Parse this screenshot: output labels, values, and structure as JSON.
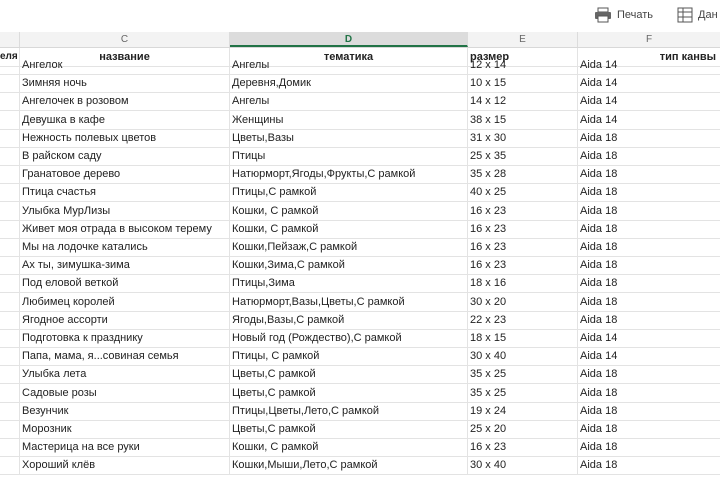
{
  "toolbar": {
    "print_label": "Печать",
    "data_label": "Дан"
  },
  "columns": {
    "stub": "еля",
    "c": "C",
    "d": "D",
    "e": "E",
    "f": "F"
  },
  "header_row": {
    "name": "название",
    "theme": "тематика",
    "size": "размер",
    "canvas": "тип канвы"
  },
  "rows": [
    {
      "name": "Ангелок",
      "theme": "Ангелы",
      "size": "12 x 14",
      "canvas": "Aida 14"
    },
    {
      "name": "Зимняя ночь",
      "theme": "Деревня,Домик",
      "size": "10 x 15",
      "canvas": "Aida 14"
    },
    {
      "name": "Ангелочек в розовом",
      "theme": "Ангелы",
      "size": "14 x 12",
      "canvas": "Aida 14"
    },
    {
      "name": "Девушка в кафе",
      "theme": "Женщины",
      "size": "38 x 15",
      "canvas": "Aida 14"
    },
    {
      "name": "Нежность полевых цветов",
      "theme": "Цветы,Вазы",
      "size": "31 x 30",
      "canvas": "Aida 18"
    },
    {
      "name": "В райском саду",
      "theme": "Птицы",
      "size": "25 x 35",
      "canvas": "Aida 18"
    },
    {
      "name": "Гранатовое дерево",
      "theme": "Натюрморт,Ягоды,Фрукты,С рамкой",
      "size": "35 x 28",
      "canvas": "Aida 18"
    },
    {
      "name": "Птица счастья",
      "theme": "Птицы,С рамкой",
      "size": "40 x 25",
      "canvas": "Aida 18"
    },
    {
      "name": "Улыбка МурЛизы",
      "theme": "Кошки, С рамкой",
      "size": "16 x 23",
      "canvas": "Aida 18"
    },
    {
      "name": "Живет моя отрада в высоком терему",
      "theme": "Кошки, С рамкой",
      "size": "16 x 23",
      "canvas": "Aida 18"
    },
    {
      "name": "Мы на лодочке катались",
      "theme": "Кошки,Пейзаж,С рамкой",
      "size": "16 x 23",
      "canvas": "Aida 18"
    },
    {
      "name": "Ах ты, зимушка-зима",
      "theme": "Кошки,Зима,С рамкой",
      "size": "16 x 23",
      "canvas": "Aida 18"
    },
    {
      "name": "Под еловой веткой",
      "theme": "Птицы,Зима",
      "size": "18 x 16",
      "canvas": "Aida 18"
    },
    {
      "name": "Любимец королей",
      "theme": "Натюрморт,Вазы,Цветы,С рамкой",
      "size": "30 x 20",
      "canvas": "Aida 18"
    },
    {
      "name": "Ягодное ассорти",
      "theme": "Ягоды,Вазы,С рамкой",
      "size": " 22 x 23",
      "canvas": "Aida 18"
    },
    {
      "name": "Подготовка к празднику",
      "theme": "Новый год (Рождество),С рамкой",
      "size": "18 x 15",
      "canvas": "Aida 14"
    },
    {
      "name": "Папа, мама, я...совиная семья",
      "theme": "Птицы, С рамкой",
      "size": "30 x 40",
      "canvas": "Aida 14"
    },
    {
      "name": "Улыбка лета",
      "theme": "Цветы,С рамкой",
      "size": "35 x 25",
      "canvas": "Aida 18"
    },
    {
      "name": "Садовые розы",
      "theme": "Цветы,С рамкой",
      "size": "35 x 25",
      "canvas": "Aida 18"
    },
    {
      "name": "Везунчик",
      "theme": "Птицы,Цветы,Лето,С рамкой",
      "size": "19 x 24",
      "canvas": "Aida 18"
    },
    {
      "name": "Морозник",
      "theme": "Цветы,С рамкой",
      "size": "25 x 20",
      "canvas": "Aida 18"
    },
    {
      "name": "Мастерица на все руки",
      "theme": "Кошки, С рамкой",
      "size": "16 x 23",
      "canvas": "Aida 18"
    },
    {
      "name": "Хороший клёв",
      "theme": "Кошки,Мыши,Лето,С рамкой",
      "size": "30 x 40",
      "canvas": "Aida 18"
    }
  ]
}
